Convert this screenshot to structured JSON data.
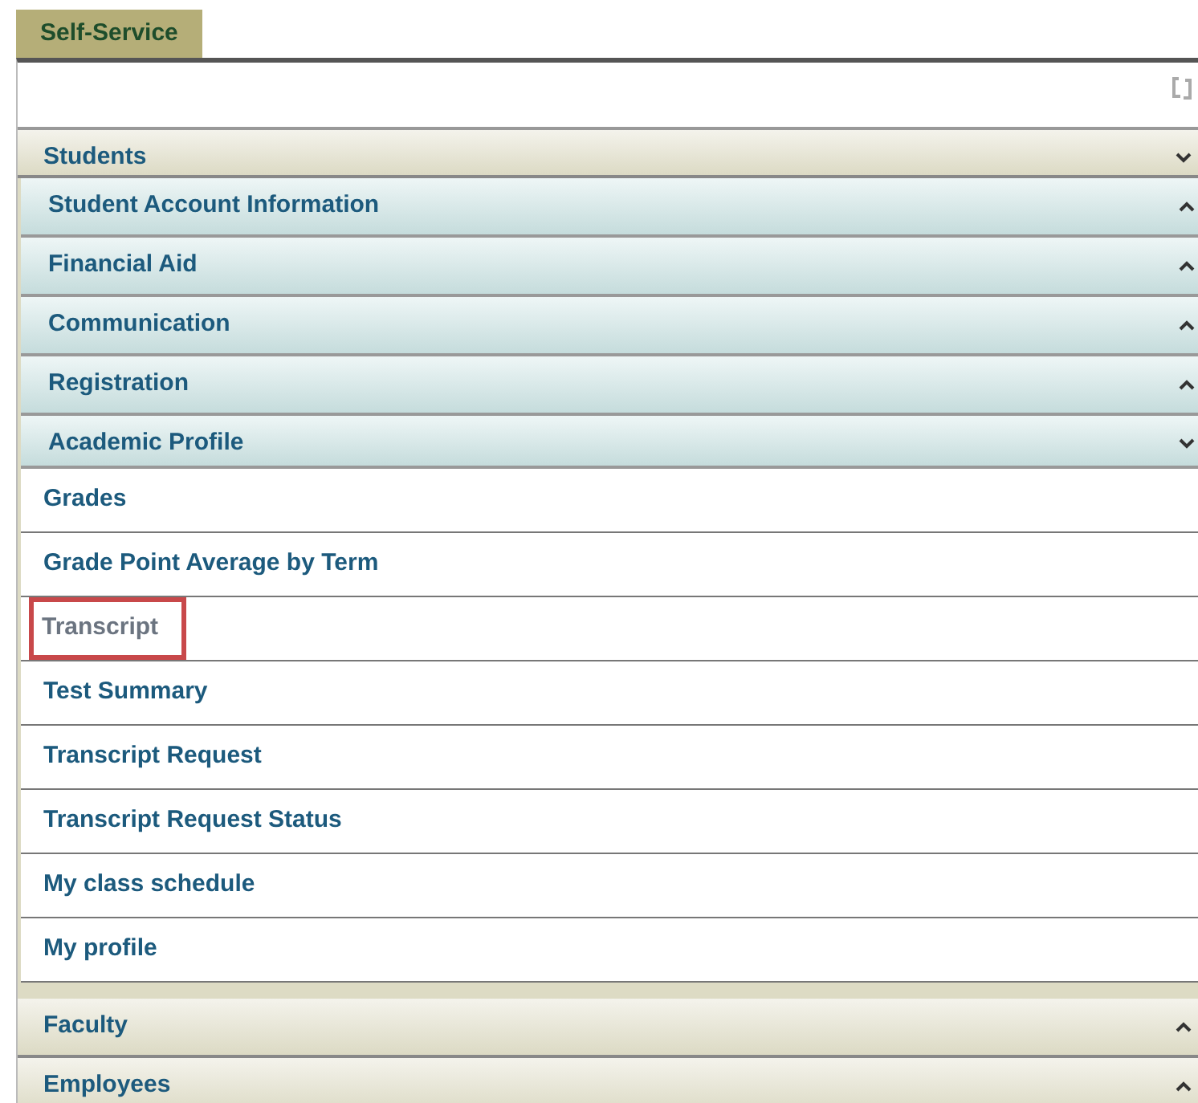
{
  "tab": {
    "label": "Self-Service"
  },
  "sections": [
    {
      "title": "Students",
      "expanded": true,
      "groups": [
        {
          "title": "Student Account Information",
          "expanded": false
        },
        {
          "title": "Financial Aid",
          "expanded": false
        },
        {
          "title": "Communication",
          "expanded": false
        },
        {
          "title": "Registration",
          "expanded": false
        },
        {
          "title": "Academic Profile",
          "expanded": true,
          "links": [
            {
              "label": "Grades",
              "selected": false
            },
            {
              "label": "Grade Point Average by Term",
              "selected": false
            },
            {
              "label": "Transcript",
              "selected": true
            },
            {
              "label": "Test Summary",
              "selected": false
            },
            {
              "label": "Transcript Request",
              "selected": false
            },
            {
              "label": "Transcript Request Status",
              "selected": false
            },
            {
              "label": "My class schedule",
              "selected": false
            },
            {
              "label": "My profile",
              "selected": false
            }
          ]
        }
      ]
    },
    {
      "title": "Faculty",
      "expanded": false
    },
    {
      "title": "Employees",
      "expanded": false
    }
  ]
}
